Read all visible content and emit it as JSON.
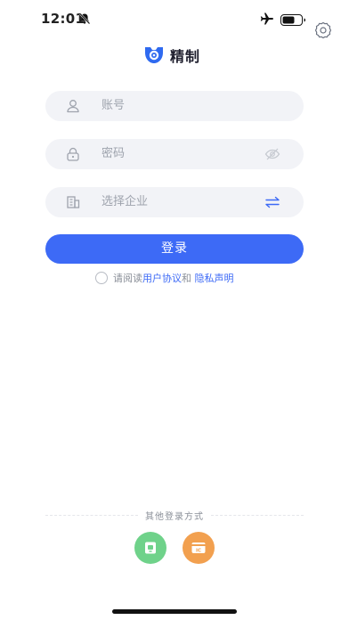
{
  "status_bar": {
    "time": "12:01"
  },
  "app": {
    "name": "精制",
    "brand_color": "#3d6af6"
  },
  "form": {
    "account_placeholder": "账号",
    "password_placeholder": "密码",
    "company_placeholder": "选择企业"
  },
  "login_button": "登录",
  "agreement": {
    "prefix": "请阅读",
    "user_agreement": "用户协议",
    "and": "和 ",
    "privacy_policy": "隐私声明"
  },
  "other_login": {
    "title": "其他登录方式"
  },
  "icons": {
    "bell_off": "bell-off-icon",
    "airplane": "airplane-icon",
    "battery": "battery-icon",
    "settings": "gear-icon",
    "account": "user-icon",
    "password": "lock-icon",
    "eye": "eye-off-icon",
    "company": "building-icon",
    "switch": "swap-icon",
    "wechat": "wechat-login-icon",
    "card": "ic-card-icon"
  }
}
